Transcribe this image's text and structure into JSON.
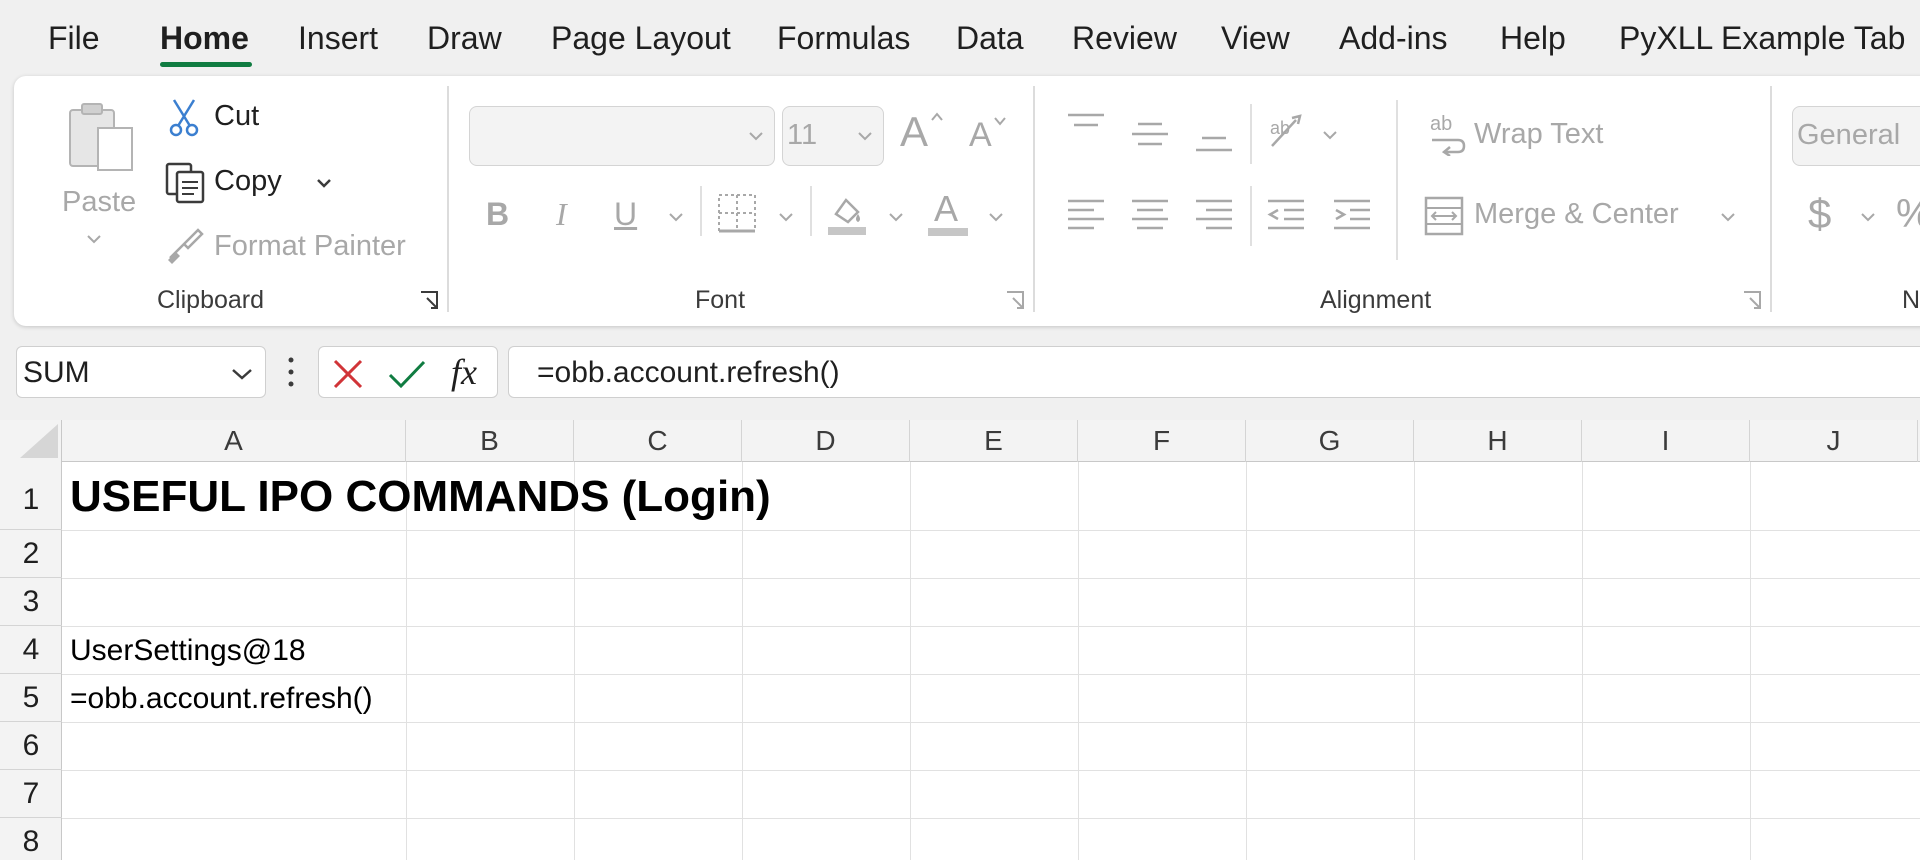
{
  "menu": {
    "tabs": [
      "File",
      "Home",
      "Insert",
      "Draw",
      "Page Layout",
      "Formulas",
      "Data",
      "Review",
      "View",
      "Add-ins",
      "Help",
      "PyXLL Example Tab"
    ],
    "active": "Home",
    "accent_color": "#107c41"
  },
  "ribbon": {
    "clipboard": {
      "paste_label": "Paste",
      "cut_label": "Cut",
      "copy_label": "Copy",
      "format_painter_label": "Format Painter",
      "group_label": "Clipboard"
    },
    "font": {
      "font_name_value": "",
      "font_size_value": "11",
      "bold": "B",
      "italic": "I",
      "underline": "U",
      "font_color_glyph": "A",
      "grow_glyph": "A",
      "shrink_glyph": "A",
      "group_label": "Font"
    },
    "alignment": {
      "wrap_text_label": "Wrap Text",
      "merge_center_label": "Merge & Center",
      "group_label": "Alignment"
    },
    "number": {
      "format_value": "General",
      "currency_glyph": "$",
      "percent_glyph": "%",
      "group_label_partial": "N"
    }
  },
  "formula_bar": {
    "name_box": "SUM",
    "fx_label": "fx",
    "formula": "=obb.account.refresh()"
  },
  "sheet": {
    "columns": [
      "A",
      "B",
      "C",
      "D",
      "E",
      "F",
      "G",
      "H",
      "I",
      "J"
    ],
    "rows": [
      "1",
      "2",
      "3",
      "4",
      "5",
      "6",
      "7",
      "8"
    ],
    "cells": {
      "A1": "USEFUL IPO COMMANDS (Login)",
      "A4": "UserSettings@18",
      "A5": "=obb.account.refresh()"
    }
  }
}
